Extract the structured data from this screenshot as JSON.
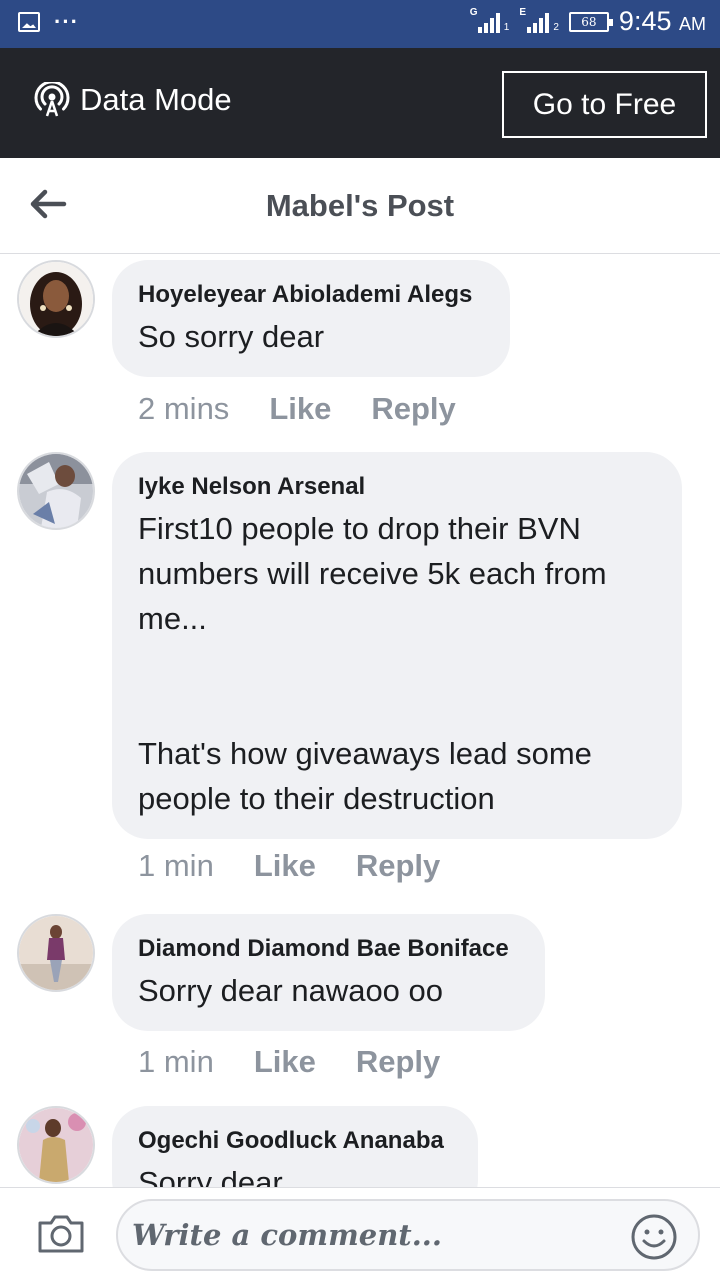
{
  "status_bar": {
    "network1": "G",
    "sim1": "1",
    "network2": "E",
    "sim2": "2",
    "battery": "68",
    "time": "9:45",
    "ampm": "AM",
    "icons": [
      "image-icon",
      "more-dots-icon",
      "signal-icon",
      "battery-icon"
    ]
  },
  "data_bar": {
    "label": "Data Mode",
    "button": "Go to Free",
    "icon": "broadcast-icon"
  },
  "header": {
    "title": "Mabel's Post",
    "back_icon": "arrow-left-icon"
  },
  "comments": [
    {
      "author": "Hoyeleyear Abiolademi Alegs",
      "text": "So sorry dear",
      "time": "2 mins",
      "like": "Like",
      "reply": "Reply"
    },
    {
      "author": "Iyke Nelson Arsenal",
      "text": "First10 people to drop their BVN\nnumbers will receive 5k each from\nme...\n\n\nThat's how giveaways lead some\npeople to their destruction",
      "time": "1 min",
      "like": "Like",
      "reply": "Reply"
    },
    {
      "author": "Diamond Diamond Bae Boniface",
      "text": "Sorry dear nawaoo oo",
      "time": "1 min",
      "like": "Like",
      "reply": "Reply"
    },
    {
      "author": "Ogechi Goodluck Ananaba",
      "text": "Sorry dear"
    }
  ],
  "bottom_bar": {
    "placeholder": "Write a comment...",
    "camera_icon": "camera-icon",
    "emoji_icon": "emoji-icon"
  },
  "colors": {
    "status_bar": "#2d4a86",
    "data_bar": "#23252a",
    "bubble": "#f0f1f4",
    "meta_text": "#8d949e",
    "title_text": "#4b4f56"
  }
}
